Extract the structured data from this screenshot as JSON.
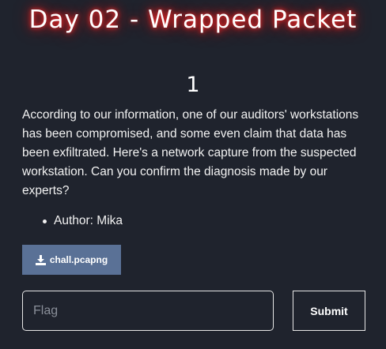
{
  "challenge": {
    "title": "Day 02 - Wrapped Packet",
    "points": "1",
    "description": "According to our information, one of our auditors' workstations has been compromised, and some even claim that data has been exfiltrated. Here's a network capture from the suspected workstation. Can you confirm the diagnosis made by our experts?",
    "author": "Author: Mika"
  },
  "download": {
    "file_label": "chall.pcapng",
    "icon": "download-icon",
    "color": "#5a7196"
  },
  "form": {
    "flag_placeholder": "Flag",
    "flag_value": "",
    "submit_label": "Submit"
  },
  "theme": {
    "background": "#1f232d",
    "title_glow": "#d81b1b"
  }
}
